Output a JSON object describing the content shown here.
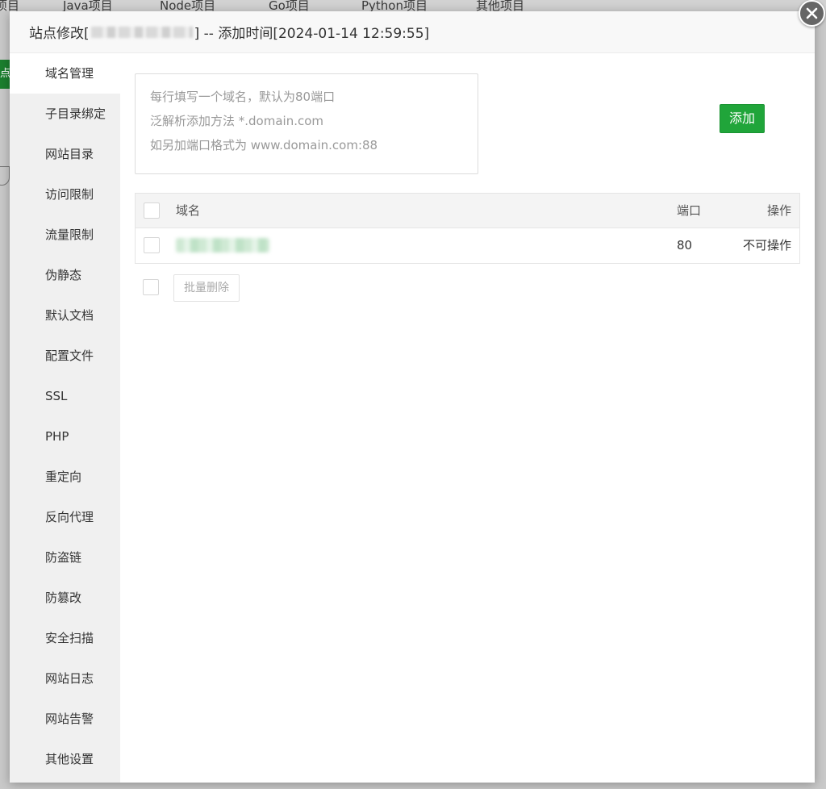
{
  "background": {
    "tabs": [
      "项目",
      "Java项目",
      "Node项目",
      "Go项目",
      "Python项目",
      "其他项目"
    ],
    "button_fragment": "点"
  },
  "modal": {
    "title_prefix": "站点修改[",
    "title_suffix": "] -- 添加时间[2024-01-14 12:59:55]",
    "sidebar": [
      "域名管理",
      "子目录绑定",
      "网站目录",
      "访问限制",
      "流量限制",
      "伪静态",
      "默认文档",
      "配置文件",
      "SSL",
      "PHP",
      "重定向",
      "反向代理",
      "防盗链",
      "防篡改",
      "安全扫描",
      "网站日志",
      "网站告警",
      "其他设置"
    ],
    "active_index": 0,
    "domain_input": {
      "placeholder_lines": [
        "每行填写一个域名，默认为80端口",
        "泛解析添加方法 *.domain.com",
        "如另加端口格式为 www.domain.com:88"
      ]
    },
    "add_button": "添加",
    "table": {
      "headers": {
        "name": "域名",
        "port": "端口",
        "op": "操作"
      },
      "rows": [
        {
          "port": "80",
          "op": "不可操作"
        }
      ]
    },
    "bulk_delete": "批量删除"
  },
  "colors": {
    "accent": "#20a53a",
    "sidebar_bg": "#f0f0f0"
  },
  "icons": {
    "close": "close-icon"
  }
}
